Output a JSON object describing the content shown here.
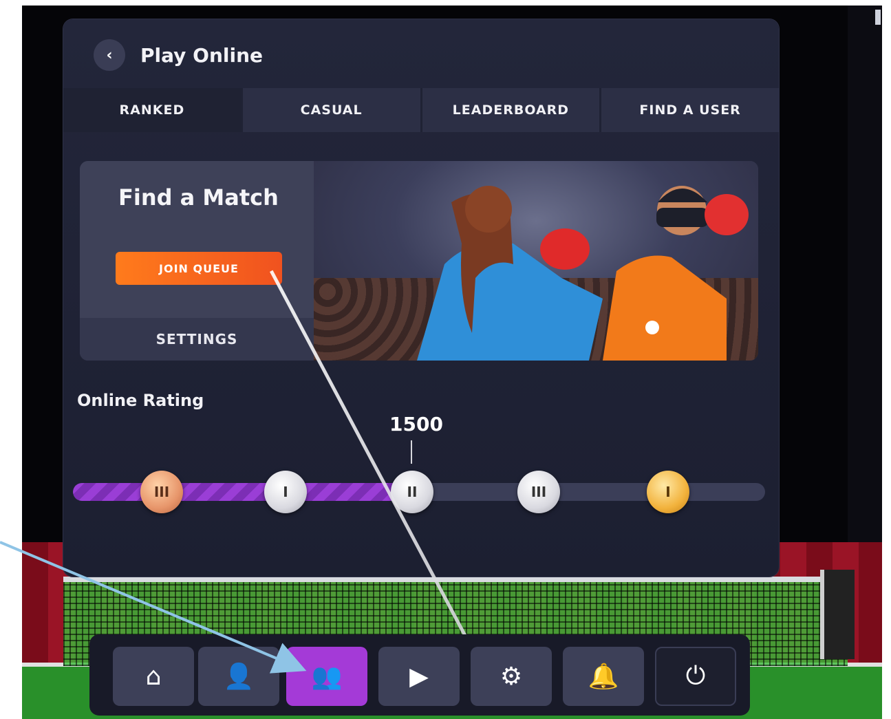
{
  "header": {
    "back_icon": "chevron-left-icon",
    "title": "Play Online"
  },
  "tabs": [
    {
      "label": "RANKED",
      "active": true
    },
    {
      "label": "CASUAL",
      "active": false
    },
    {
      "label": "LEADERBOARD",
      "active": false
    },
    {
      "label": "FIND A USER",
      "active": false
    }
  ],
  "match": {
    "title": "Find a Match",
    "join_label": "JOIN QUEUE",
    "settings_label": "SETTINGS"
  },
  "rating": {
    "label": "Online Rating",
    "value": "1500",
    "progress": 0.49,
    "medals": [
      {
        "tier": "bronze",
        "numeral": "III"
      },
      {
        "tier": "silver",
        "numeral": "I"
      },
      {
        "tier": "silver",
        "numeral": "II"
      },
      {
        "tier": "silver",
        "numeral": "III"
      },
      {
        "tier": "gold",
        "numeral": "I"
      }
    ]
  },
  "dock": [
    {
      "icon": "home-icon",
      "glyph": "⌂"
    },
    {
      "icon": "profile-icon",
      "glyph": "👤"
    },
    {
      "icon": "play-online-icon",
      "glyph": "👥",
      "active": true
    },
    {
      "icon": "replay-book-icon",
      "glyph": "▶"
    },
    {
      "icon": "gear-icon",
      "glyph": "⚙"
    },
    {
      "icon": "bell-icon",
      "glyph": "🔔"
    },
    {
      "icon": "power-icon",
      "glyph": "⏻"
    }
  ],
  "colors": {
    "accent_purple": "#a43ad7",
    "join_orange": "#f0521f",
    "annotation_arrow": "#8fc4e6"
  }
}
